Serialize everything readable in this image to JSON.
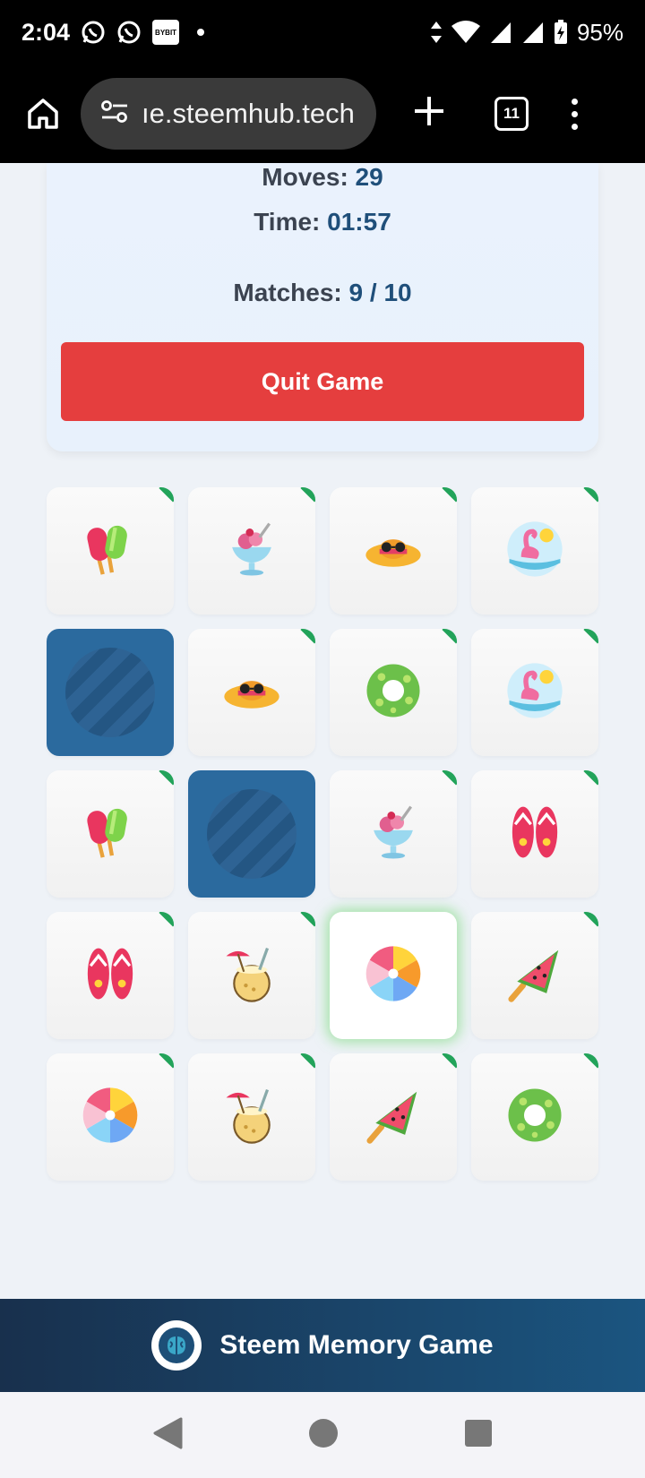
{
  "status": {
    "time": "2:04",
    "battery": "95%",
    "bybit": "BYBIT"
  },
  "browser": {
    "url": "ıe.steemhub.tech",
    "tab_count": "11"
  },
  "stats": {
    "moves_label": "Moves:",
    "moves": "29",
    "time_label": "Time:",
    "time": "01:57",
    "matches_label": "Matches:",
    "matches": "9 / 10"
  },
  "quit_label": "Quit Game",
  "board": [
    {
      "icon": "popsicle-icon",
      "state": "matched"
    },
    {
      "icon": "ice-cream-sundae-icon",
      "state": "matched"
    },
    {
      "icon": "sun-hat-icon",
      "state": "matched"
    },
    {
      "icon": "flamingo-float-icon",
      "state": "matched"
    },
    {
      "icon": "card-back-icon",
      "state": "hidden"
    },
    {
      "icon": "sun-hat-icon",
      "state": "matched"
    },
    {
      "icon": "swim-ring-icon",
      "state": "matched"
    },
    {
      "icon": "flamingo-float-icon",
      "state": "matched"
    },
    {
      "icon": "popsicle-icon",
      "state": "matched"
    },
    {
      "icon": "card-back-icon",
      "state": "hidden"
    },
    {
      "icon": "ice-cream-sundae-icon",
      "state": "matched"
    },
    {
      "icon": "flip-flops-icon",
      "state": "matched"
    },
    {
      "icon": "flip-flops-icon",
      "state": "matched"
    },
    {
      "icon": "coconut-drink-icon",
      "state": "matched"
    },
    {
      "icon": "beach-ball-icon",
      "state": "selected"
    },
    {
      "icon": "watermelon-popsicle-icon",
      "state": "matched"
    },
    {
      "icon": "beach-ball-icon",
      "state": "matched"
    },
    {
      "icon": "coconut-drink-icon",
      "state": "matched"
    },
    {
      "icon": "watermelon-popsicle-icon",
      "state": "matched"
    },
    {
      "icon": "swim-ring-icon",
      "state": "matched"
    }
  ],
  "footer": {
    "title": "Steem Memory Game"
  },
  "colors": {
    "accent": "#1f4f7a",
    "quit": "#e53e3e",
    "card_back": "#2b6a9e",
    "match_tag": "#22a35a"
  }
}
